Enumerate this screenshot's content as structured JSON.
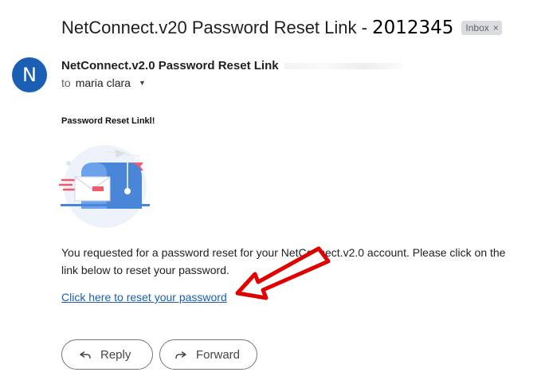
{
  "email": {
    "subject": "NetConnect.v20 Password Reset Link -",
    "subject_id": "2012345",
    "label": "Inbox",
    "label_close": "×",
    "sender_initial": "N",
    "sender_name": "NetConnect.v2.0 Password Reset Link",
    "to_prefix": "to",
    "recipient": "maria clara",
    "recipient_caret": "▼"
  },
  "body": {
    "heading": "Password Reset Linkl!",
    "paragraph": "You requested for a password reset for your NetConnect.v2.0 account. Please click on the link below to reset your password.",
    "link_text": "Click here to reset your password"
  },
  "actions": {
    "reply_label": "Reply",
    "forward_label": "Forward"
  },
  "colors": {
    "avatar": "#1a5fb4",
    "link": "#1a5fb4",
    "annotation_arrow": "#e10000"
  },
  "icons": {
    "reply": "reply-icon",
    "forward": "forward-icon",
    "illustration": "mailbox-illustration"
  }
}
